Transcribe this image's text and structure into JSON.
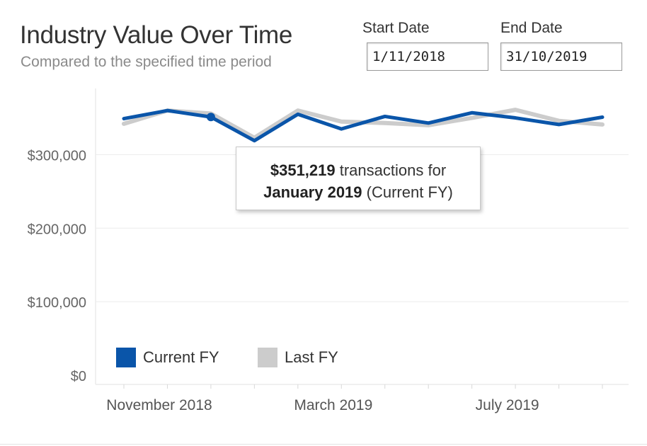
{
  "header": {
    "title": "Industry Value Over Time",
    "subtitle": "Compared to the specified time period"
  },
  "filters": {
    "start_label": "Start Date",
    "start_value": "1/11/2018",
    "end_label": "End Date",
    "end_value": "31/10/2019"
  },
  "tooltip": {
    "value": "$351,219",
    "text1": " transactions for",
    "period": "January 2019",
    "text2": " (Current FY)"
  },
  "legend": {
    "current": {
      "label": "Current FY",
      "color": "#0a55a9"
    },
    "last": {
      "label": "Last FY",
      "color": "#cccccc"
    }
  },
  "chart_data": {
    "type": "line",
    "x": [
      "2018-11",
      "2018-12",
      "2019-01",
      "2019-02",
      "2019-03",
      "2019-04",
      "2019-05",
      "2019-06",
      "2019-07",
      "2019-08",
      "2019-09",
      "2019-10"
    ],
    "series": [
      {
        "name": "Current FY",
        "color": "#0a55a9",
        "values": [
          349000,
          360000,
          351219,
          319000,
          355000,
          335000,
          352000,
          343000,
          357000,
          350000,
          341000,
          351000
        ]
      },
      {
        "name": "Last FY",
        "color": "#cccccc",
        "values": [
          342000,
          360000,
          356000,
          323000,
          360000,
          345000,
          343000,
          340000,
          350000,
          361000,
          346000,
          341000
        ]
      }
    ],
    "highlight_index": 2,
    "xtick_labels": [
      "November 2018",
      "March 2019",
      "July 2019"
    ],
    "xtick_indices": [
      0,
      4,
      8
    ],
    "ytick_values": [
      0,
      100000,
      200000,
      300000
    ],
    "ytick_labels": [
      "$0",
      "$100,000",
      "$200,000",
      "$300,000"
    ],
    "ylim": [
      0,
      390000
    ],
    "grid": true
  }
}
